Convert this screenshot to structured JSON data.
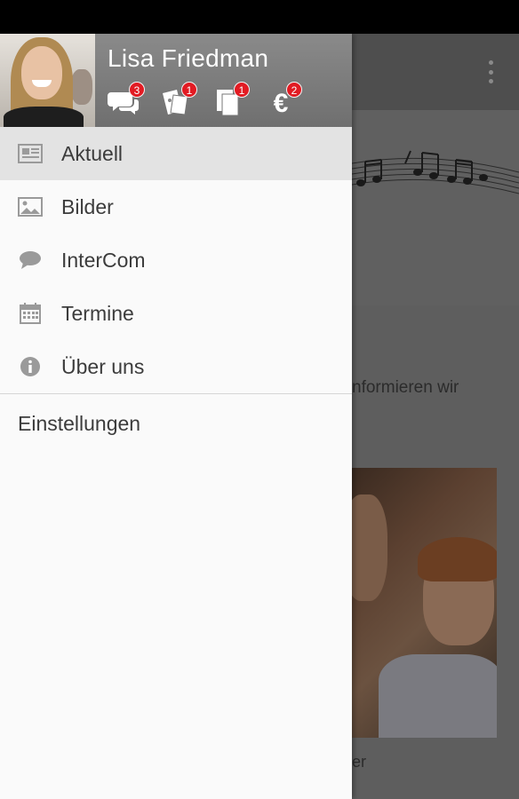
{
  "user": {
    "name": "Lisa Friedman"
  },
  "header_icons": [
    {
      "icon": "chat-bubbles-icon",
      "badge": "3"
    },
    {
      "icon": "tickets-icon",
      "badge": "1"
    },
    {
      "icon": "documents-icon",
      "badge": "1"
    },
    {
      "icon": "euro-icon",
      "badge": "2"
    }
  ],
  "menu": {
    "items": [
      {
        "label": "Aktuell",
        "icon": "news-icon",
        "active": true
      },
      {
        "label": "Bilder",
        "icon": "image-icon"
      },
      {
        "label": "InterCom",
        "icon": "chat-icon"
      },
      {
        "label": "Termine",
        "icon": "calendar-icon"
      },
      {
        "label": "Über uns",
        "icon": "info-icon"
      }
    ],
    "settings_label": "Einstellungen"
  },
  "background": {
    "text_line_1": "nformieren wir",
    "text_line_2": "",
    "text_line_3": "er"
  },
  "colors": {
    "badge": "#e21b23",
    "header": "#7a7a7a",
    "active_item": "#e3e3e3"
  }
}
